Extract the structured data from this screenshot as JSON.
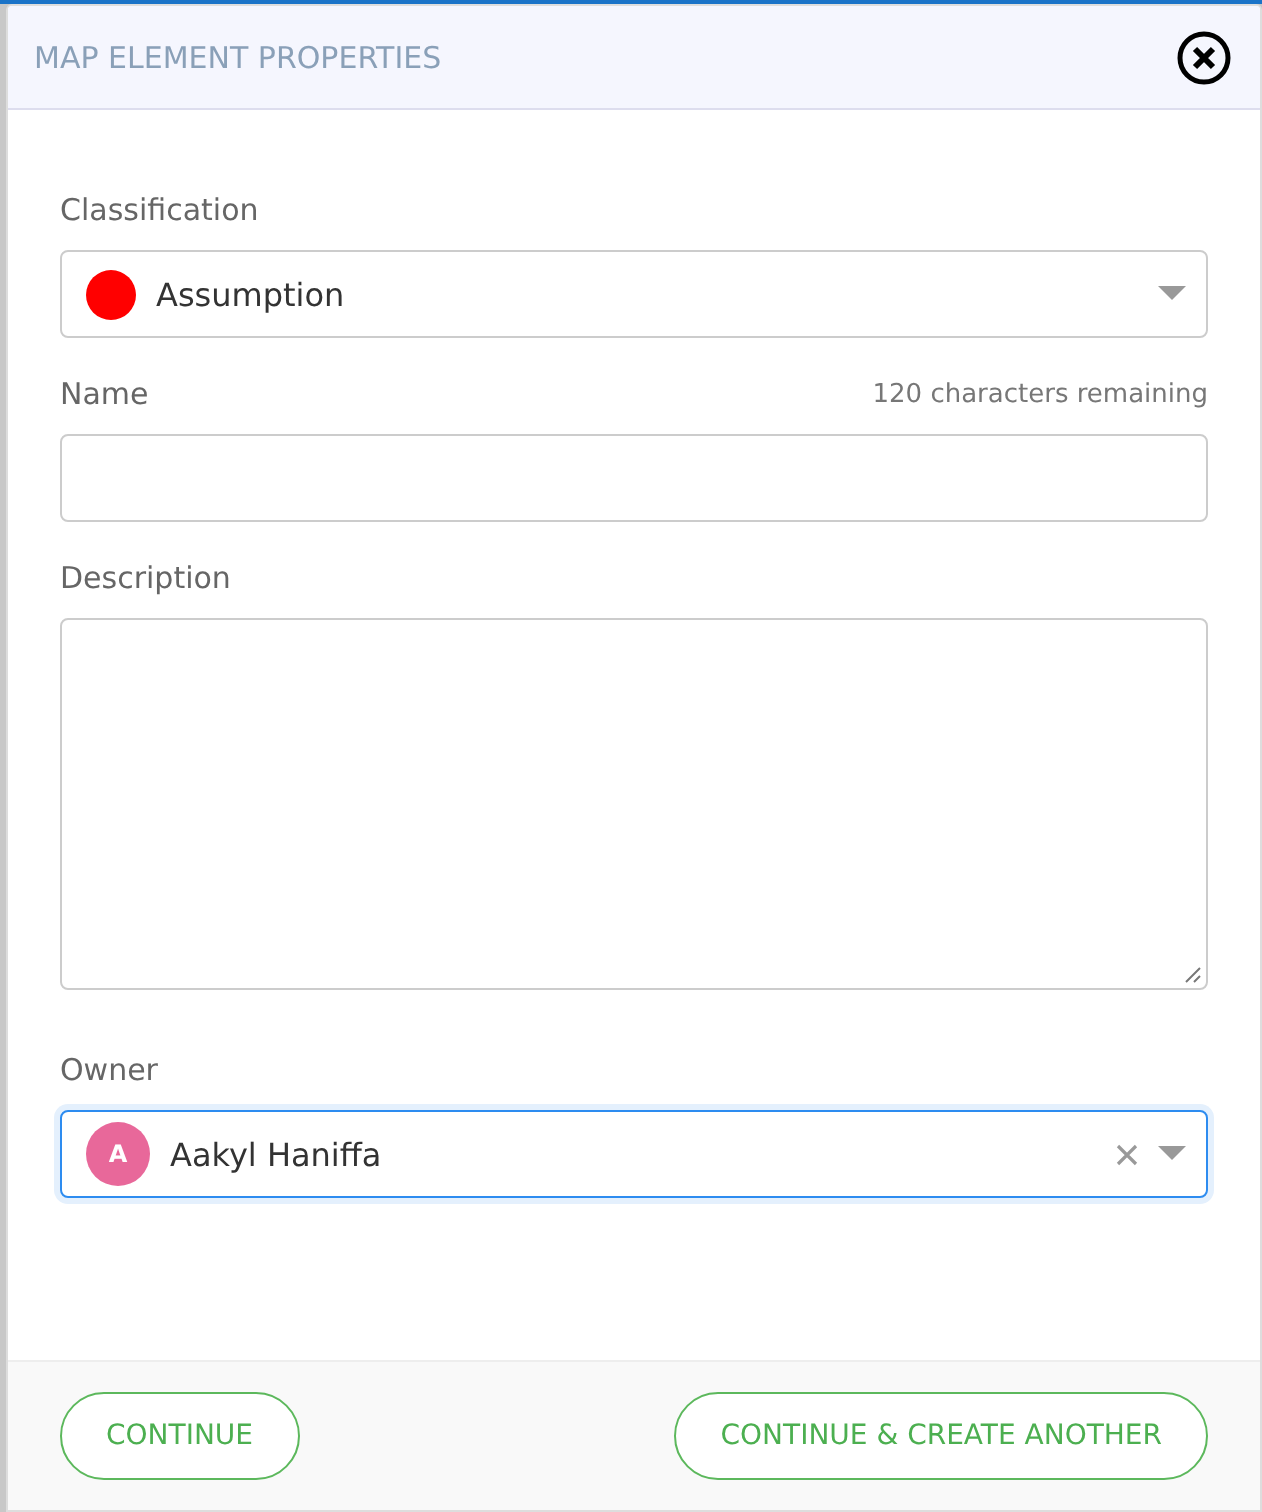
{
  "dialog": {
    "title": "MAP ELEMENT PROPERTIES"
  },
  "fields": [
    {
      "kind": "classification",
      "label": "Classification",
      "value": "Assumption",
      "color": "#ff0000"
    },
    {
      "kind": "text",
      "label": "Name",
      "counter": "120 characters remaining"
    },
    {
      "kind": "textarea",
      "label": "Description"
    },
    {
      "kind": "person",
      "label": "Owner",
      "initial": "A",
      "value": "Aakyl Haniffa",
      "focused": true
    }
  ],
  "buttons": [
    {
      "label": "CONTINUE"
    },
    {
      "label": "CONTINUE & CREATE ANOTHER"
    }
  ]
}
